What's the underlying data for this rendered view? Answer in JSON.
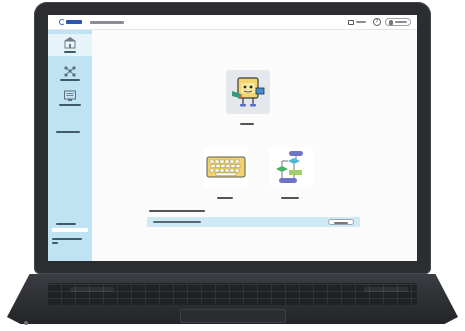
{
  "header": {
    "logo_text": "",
    "app_title": "",
    "record_label": "",
    "help_label": "?",
    "user_label": ""
  },
  "sidebar": {
    "items": [
      {
        "icon": "school-building-icon",
        "label": "",
        "active": true
      },
      {
        "icon": "network-nodes-icon",
        "label": ""
      },
      {
        "icon": "monitor-list-icon",
        "label": ""
      },
      {
        "icon": "",
        "label": ""
      }
    ],
    "bottom_button_label": "",
    "footer_text": ""
  },
  "main": {
    "featured": {
      "icon": "character-mascot-icon",
      "label": ""
    },
    "tiles": [
      {
        "icon": "keyboard-icon",
        "label": ""
      },
      {
        "icon": "flowchart-icon",
        "label": ""
      }
    ],
    "notice": {
      "heading": "",
      "text": "",
      "button_label": ""
    }
  },
  "colors": {
    "sidebar": "#bfe3f2",
    "notice_bar": "#cfe9f5",
    "accent": "#2e56b0",
    "bezel": "#2b2d31"
  }
}
